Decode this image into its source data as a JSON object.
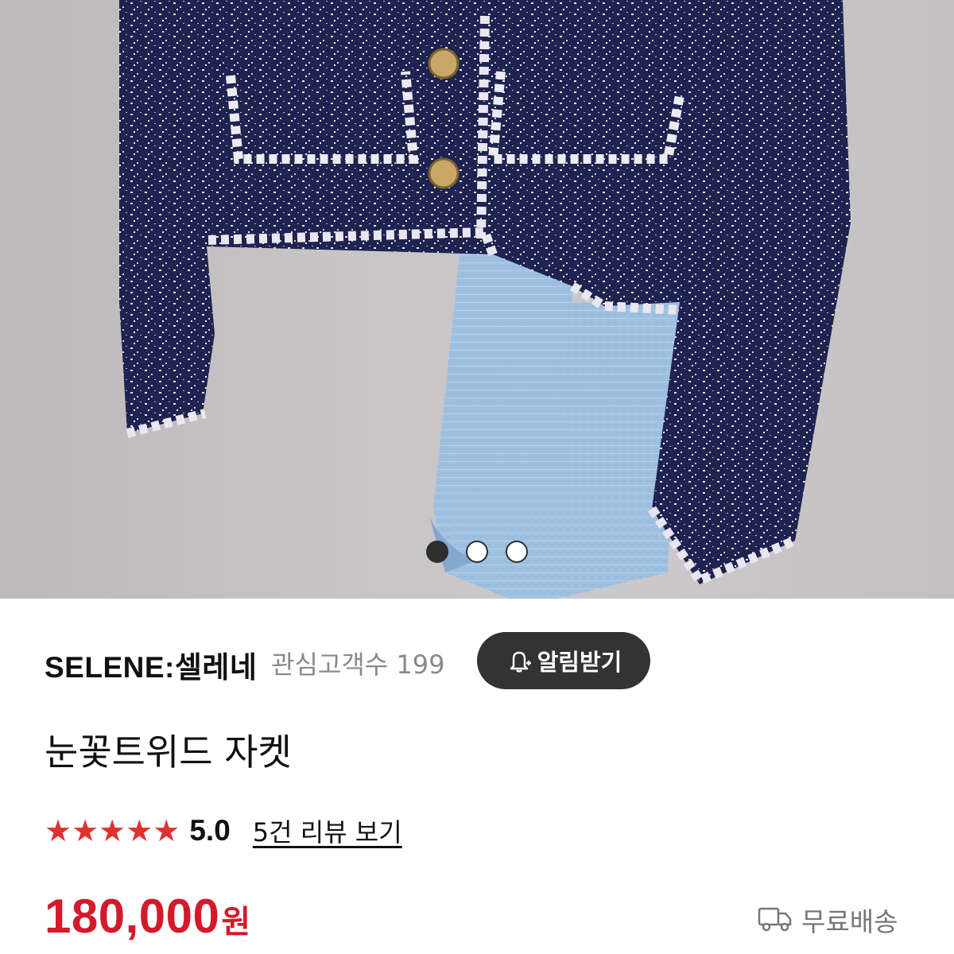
{
  "hero": {
    "image_alt": "",
    "carousel": {
      "total": 3,
      "active_index": 0
    }
  },
  "seller": {
    "name": "SELENE:셀레네",
    "followers_text": "관심고객수 199",
    "notify_label": "알림받기"
  },
  "product": {
    "title": "눈꽃트위드 자켓",
    "rating_stars": "★★★★★",
    "rating_value": "5.0",
    "review_link": "5건 리뷰 보기",
    "price": "180,000",
    "currency": "원",
    "shipping_label": "무료배송"
  },
  "colors": {
    "price_red": "#d41a2a",
    "star_red": "#e03131",
    "button_dark": "#333333"
  },
  "icons": {
    "notify": "bell-plus-icon",
    "shipping": "truck-icon"
  }
}
